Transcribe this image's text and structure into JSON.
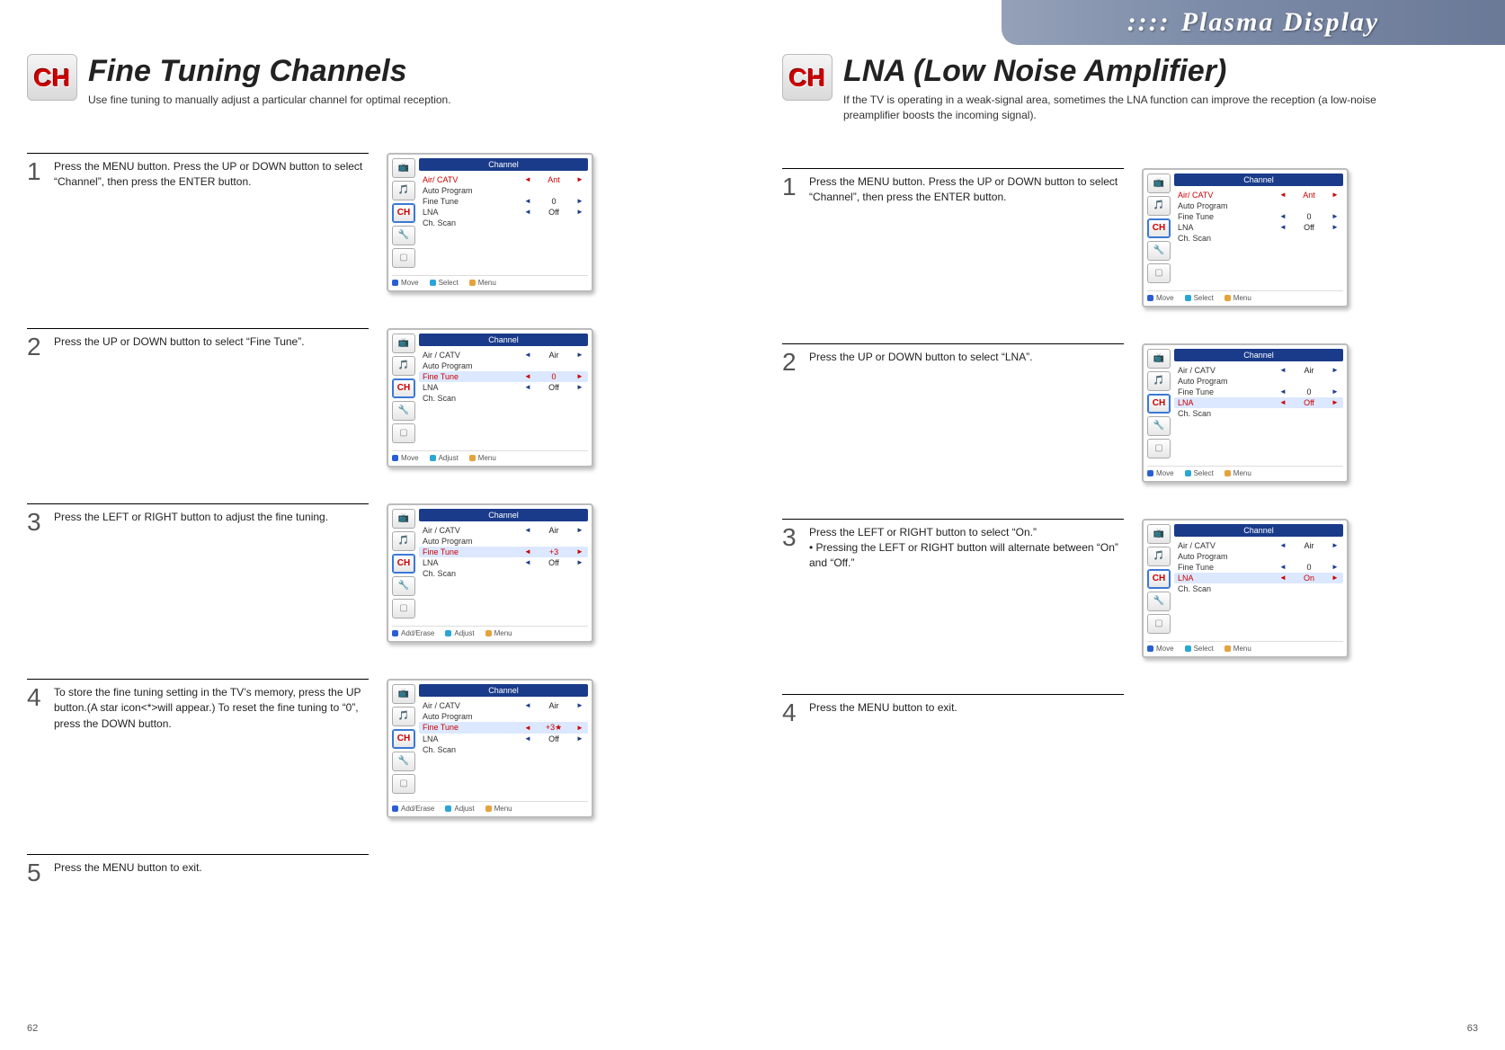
{
  "brand": "Plasma Display",
  "pageLeft": {
    "number": "62",
    "heading": "Fine Tuning Channels",
    "subheading": "Use fine tuning to manually adjust a particular channel for optimal reception."
  },
  "pageRight": {
    "number": "63",
    "heading": "LNA (Low Noise Amplifier)",
    "subheading": "If the TV is operating in a weak-signal area, sometimes the LNA function can improve the reception (a low-noise preamplifier boosts the incoming signal)."
  },
  "stepsLeft": [
    {
      "num": "1",
      "text": "Press the MENU button. Press the UP or DOWN button to select “Channel”, then press the ENTER button.",
      "osd": {
        "title": "Channel",
        "rows": [
          {
            "label": "Air/ CATV",
            "value": "Ant",
            "hl": "red"
          },
          {
            "label": "Auto Program",
            "value": "",
            "hl": ""
          },
          {
            "label": "Fine Tune",
            "value": "0",
            "hl": ""
          },
          {
            "label": "LNA",
            "value": "Off",
            "hl": ""
          },
          {
            "label": "Ch. Scan",
            "value": "",
            "hl": ""
          }
        ],
        "hints": [
          {
            "dot": "blue",
            "t": "Move"
          },
          {
            "dot": "cyan",
            "t": "Select"
          },
          {
            "dot": "orange",
            "t": "Menu"
          }
        ]
      }
    },
    {
      "num": "2",
      "text": "Press the UP or DOWN button to select “Fine Tune”.",
      "osd": {
        "title": "Channel",
        "rows": [
          {
            "label": "Air / CATV",
            "value": "Air",
            "hl": ""
          },
          {
            "label": "Auto Program",
            "value": "",
            "hl": ""
          },
          {
            "label": "Fine Tune",
            "value": "0",
            "hl": "red",
            "bg": true
          },
          {
            "label": "LNA",
            "value": "Off",
            "hl": ""
          },
          {
            "label": "Ch. Scan",
            "value": "",
            "hl": ""
          }
        ],
        "hints": [
          {
            "dot": "blue",
            "t": "Move"
          },
          {
            "dot": "cyan",
            "t": "Adjust"
          },
          {
            "dot": "orange",
            "t": "Menu"
          }
        ]
      }
    },
    {
      "num": "3",
      "text": "Press the LEFT or RIGHT button to adjust the fine tuning.",
      "osd": {
        "title": "Channel",
        "rows": [
          {
            "label": "Air / CATV",
            "value": "Air",
            "hl": ""
          },
          {
            "label": "Auto Program",
            "value": "",
            "hl": ""
          },
          {
            "label": "Fine Tune",
            "value": "+3",
            "hl": "red",
            "bg": true
          },
          {
            "label": "LNA",
            "value": "Off",
            "hl": ""
          },
          {
            "label": "Ch. Scan",
            "value": "",
            "hl": ""
          }
        ],
        "hints": [
          {
            "dot": "blue",
            "t": "Add/Erase"
          },
          {
            "dot": "cyan",
            "t": "Adjust"
          },
          {
            "dot": "orange",
            "t": "Menu"
          }
        ]
      }
    },
    {
      "num": "4",
      "text": "To store the fine tuning setting in the TV’s memory, press the UP button.(A star icon<*>will appear.) To reset the fine tuning to “0”, press the DOWN button.",
      "osd": {
        "title": "Channel",
        "rows": [
          {
            "label": "Air / CATV",
            "value": "Air",
            "hl": ""
          },
          {
            "label": "Auto Program",
            "value": "",
            "hl": ""
          },
          {
            "label": "Fine Tune",
            "value": "+3★",
            "hl": "red",
            "bg": true
          },
          {
            "label": "LNA",
            "value": "Off",
            "hl": ""
          },
          {
            "label": "Ch. Scan",
            "value": "",
            "hl": ""
          }
        ],
        "hints": [
          {
            "dot": "blue",
            "t": "Add/Erase"
          },
          {
            "dot": "cyan",
            "t": "Adjust"
          },
          {
            "dot": "orange",
            "t": "Menu"
          }
        ]
      }
    },
    {
      "num": "5",
      "text": "Press the MENU button to exit.",
      "osd": null
    }
  ],
  "stepsRight": [
    {
      "num": "1",
      "text": "Press the MENU button. Press the UP or DOWN button to select “Channel”, then press the ENTER button.",
      "osd": {
        "title": "Channel",
        "rows": [
          {
            "label": "Air/ CATV",
            "value": "Ant",
            "hl": "red"
          },
          {
            "label": "Auto Program",
            "value": "",
            "hl": ""
          },
          {
            "label": "Fine Tune",
            "value": "0",
            "hl": ""
          },
          {
            "label": "LNA",
            "value": "Off",
            "hl": ""
          },
          {
            "label": "Ch. Scan",
            "value": "",
            "hl": ""
          }
        ],
        "hints": [
          {
            "dot": "blue",
            "t": "Move"
          },
          {
            "dot": "cyan",
            "t": "Select"
          },
          {
            "dot": "orange",
            "t": "Menu"
          }
        ]
      }
    },
    {
      "num": "2",
      "text": "Press the UP or DOWN button to select “LNA”.",
      "osd": {
        "title": "Channel",
        "rows": [
          {
            "label": "Air / CATV",
            "value": "Air",
            "hl": ""
          },
          {
            "label": "Auto Program",
            "value": "",
            "hl": ""
          },
          {
            "label": "Fine Tune",
            "value": "0",
            "hl": ""
          },
          {
            "label": "LNA",
            "value": "Off",
            "hl": "red",
            "bg": true
          },
          {
            "label": "Ch. Scan",
            "value": "",
            "hl": ""
          }
        ],
        "hints": [
          {
            "dot": "blue",
            "t": "Move"
          },
          {
            "dot": "cyan",
            "t": "Select"
          },
          {
            "dot": "orange",
            "t": "Menu"
          }
        ]
      }
    },
    {
      "num": "3",
      "text": "Press the LEFT or RIGHT button to select “On.”\n• Pressing the LEFT or RIGHT button will alternate between “On” and “Off.”",
      "osd": {
        "title": "Channel",
        "rows": [
          {
            "label": "Air / CATV",
            "value": "Air",
            "hl": ""
          },
          {
            "label": "Auto Program",
            "value": "",
            "hl": ""
          },
          {
            "label": "Fine Tune",
            "value": "0",
            "hl": ""
          },
          {
            "label": "LNA",
            "value": "On",
            "hl": "red",
            "bg": true
          },
          {
            "label": "Ch. Scan",
            "value": "",
            "hl": ""
          }
        ],
        "hints": [
          {
            "dot": "blue",
            "t": "Move"
          },
          {
            "dot": "cyan",
            "t": "Select"
          },
          {
            "dot": "orange",
            "t": "Menu"
          }
        ]
      }
    },
    {
      "num": "4",
      "text": "Press the MENU button to exit.",
      "osd": null
    }
  ],
  "osdSidebar": [
    "📺",
    "🎵",
    "CH",
    "🔧",
    "▢"
  ]
}
